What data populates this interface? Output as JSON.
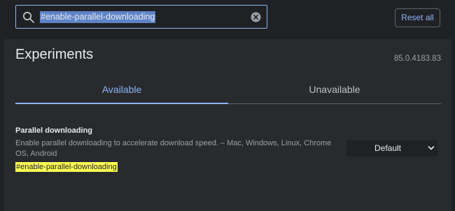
{
  "search": {
    "value": "#enable-parallel-downloading",
    "icons": {
      "search": "search-icon",
      "clear": "clear-icon"
    }
  },
  "toolbar": {
    "reset_label": "Reset all"
  },
  "page": {
    "title": "Experiments",
    "version": "85.0.4183.83"
  },
  "tabs": [
    {
      "label": "Available",
      "selected": true
    },
    {
      "label": "Unavailable",
      "selected": false
    }
  ],
  "experiment": {
    "name": "Parallel downloading",
    "description": "Enable parallel downloading to accelerate download speed. – Mac, Windows, Linux, Chrome OS, Android",
    "hash": "#enable-parallel-downloading",
    "selected_option": "Default"
  },
  "colors": {
    "accent": "#8ab4f8",
    "background": "#202124",
    "panel": "#292a2d",
    "highlight": "#ffff54"
  }
}
